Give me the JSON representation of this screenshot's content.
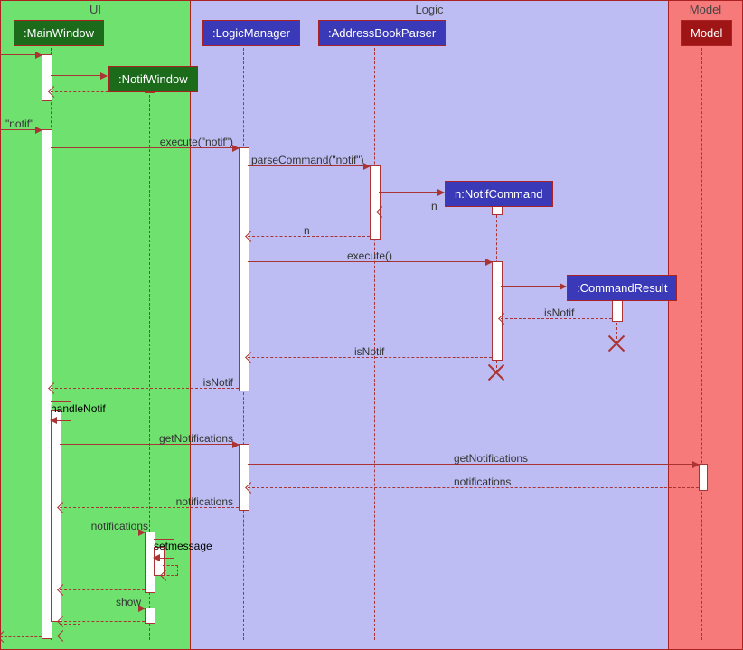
{
  "regions": {
    "ui": "UI",
    "logic": "Logic",
    "model": "Model"
  },
  "heads": {
    "mainwindow": ":MainWindow",
    "notifwindow": ":NotifWindow",
    "logicmanager": ":LogicManager",
    "addressbookparser": ":AddressBookParser",
    "notifcommand": "n:NotifCommand",
    "commandresult": ":CommandResult",
    "model": "Model"
  },
  "messages": {
    "notif_in": "\"notif\"",
    "execute_notif": "execute(\"notif\")",
    "parseCommand": "parseCommand(\"notif\")",
    "return_n1": "n",
    "return_n2": "n",
    "execute": "execute()",
    "isNotif1": "isNotif",
    "isNotif2": "isNotif",
    "isNotif3": "isNotif",
    "handleNotif": "handleNotif",
    "getNotifications1": "getNotifications",
    "getNotifications2": "getNotifications",
    "notifications1": "notifications",
    "notifications2": "notifications",
    "notifications3": "notifications",
    "setmessage": "setmessage",
    "show": "show"
  },
  "chart_data": {
    "type": "sequence_diagram",
    "regions": [
      {
        "name": "UI",
        "participants": [
          "MainWindow",
          "NotifWindow"
        ]
      },
      {
        "name": "Logic",
        "participants": [
          "LogicManager",
          "AddressBookParser",
          "NotifCommand",
          "CommandResult"
        ]
      },
      {
        "name": "Model",
        "participants": [
          "Model"
        ]
      }
    ],
    "events": [
      {
        "from": "user",
        "to": "MainWindow",
        "label": "",
        "type": "found"
      },
      {
        "from": "MainWindow",
        "to": "NotifWindow",
        "label": "",
        "type": "create"
      },
      {
        "from": "NotifWindow",
        "to": "MainWindow",
        "label": "",
        "type": "return"
      },
      {
        "from": "user",
        "to": "MainWindow",
        "label": "\"notif\"",
        "type": "found"
      },
      {
        "from": "MainWindow",
        "to": "LogicManager",
        "label": "execute(\"notif\")",
        "type": "call"
      },
      {
        "from": "LogicManager",
        "to": "AddressBookParser",
        "label": "parseCommand(\"notif\")",
        "type": "call"
      },
      {
        "from": "AddressBookParser",
        "to": "NotifCommand",
        "label": "",
        "type": "create"
      },
      {
        "from": "NotifCommand",
        "to": "AddressBookParser",
        "label": "n",
        "type": "return"
      },
      {
        "from": "AddressBookParser",
        "to": "LogicManager",
        "label": "n",
        "type": "return"
      },
      {
        "from": "LogicManager",
        "to": "NotifCommand",
        "label": "execute()",
        "type": "call"
      },
      {
        "from": "NotifCommand",
        "to": "CommandResult",
        "label": "",
        "type": "create"
      },
      {
        "from": "CommandResult",
        "to": "NotifCommand",
        "label": "isNotif",
        "type": "return"
      },
      {
        "from": "CommandResult",
        "to": "CommandResult",
        "label": "",
        "type": "destroy"
      },
      {
        "from": "NotifCommand",
        "to": "LogicManager",
        "label": "isNotif",
        "type": "return"
      },
      {
        "from": "NotifCommand",
        "to": "NotifCommand",
        "label": "",
        "type": "destroy"
      },
      {
        "from": "LogicManager",
        "to": "MainWindow",
        "label": "isNotif",
        "type": "return"
      },
      {
        "from": "MainWindow",
        "to": "MainWindow",
        "label": "handleNotif",
        "type": "self"
      },
      {
        "from": "MainWindow",
        "to": "LogicManager",
        "label": "getNotifications",
        "type": "call"
      },
      {
        "from": "LogicManager",
        "to": "Model",
        "label": "getNotifications",
        "type": "call"
      },
      {
        "from": "Model",
        "to": "LogicManager",
        "label": "notifications",
        "type": "return"
      },
      {
        "from": "LogicManager",
        "to": "MainWindow",
        "label": "notifications",
        "type": "return"
      },
      {
        "from": "MainWindow",
        "to": "NotifWindow",
        "label": "notifications",
        "type": "call"
      },
      {
        "from": "NotifWindow",
        "to": "NotifWindow",
        "label": "setmessage",
        "type": "self"
      },
      {
        "from": "NotifWindow",
        "to": "MainWindow",
        "label": "",
        "type": "return"
      },
      {
        "from": "MainWindow",
        "to": "NotifWindow",
        "label": "show",
        "type": "call"
      },
      {
        "from": "NotifWindow",
        "to": "MainWindow",
        "label": "",
        "type": "return"
      },
      {
        "from": "MainWindow",
        "to": "MainWindow",
        "label": "",
        "type": "self_return"
      },
      {
        "from": "MainWindow",
        "to": "user",
        "label": "",
        "type": "return"
      }
    ]
  }
}
